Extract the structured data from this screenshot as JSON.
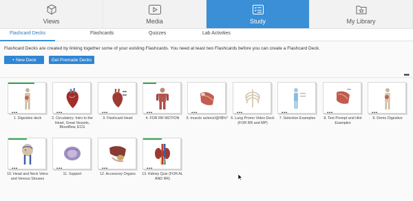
{
  "top_nav": {
    "tabs": [
      {
        "label": "Views",
        "icon": "cube-icon",
        "active": false
      },
      {
        "label": "Media",
        "icon": "play-icon",
        "active": false
      },
      {
        "label": "Study",
        "icon": "checklist-icon",
        "active": true
      },
      {
        "label": "My Library",
        "icon": "star-folder-icon",
        "active": false
      }
    ]
  },
  "sub_nav": {
    "tabs": [
      {
        "label": "Flashcard Decks",
        "active": true
      },
      {
        "label": "Flashcards",
        "active": false
      },
      {
        "label": "Quizzes",
        "active": false
      },
      {
        "label": "Lab Activities",
        "active": false
      }
    ]
  },
  "main": {
    "description": "Flashcard Decks are created by linking together some of your existing Flashcards. You need at least two Flashcards before you can create a Flashcard Deck.",
    "new_deck_label": "+ New Deck",
    "premade_label": "Get Premade Decks",
    "more_glyph": "•••",
    "card_dots": "•••"
  },
  "decks": [
    {
      "label": "1. Digestive deck",
      "progress": 0.7
    },
    {
      "label": "2. Circulatory: Intro to the Heart, Great Vessels, Bloodflow, ECG",
      "progress": 0
    },
    {
      "label": "3. Flashcard Heart",
      "progress": 0
    },
    {
      "label": "4. FOR RR MOTION",
      "progress": 0.35
    },
    {
      "label": "5. muscle actions!@#$%^",
      "progress": 0
    },
    {
      "label": "6. Lung Promo Video Deck (FOR RR and MP)",
      "progress": 0
    },
    {
      "label": "7. Selection Examples",
      "progress": 0
    },
    {
      "label": "8. Text Prompt and Hint Examples",
      "progress": 0
    },
    {
      "label": "9. Demo Digestive",
      "progress": 0
    },
    {
      "label": "10. Head and Neck Veins and Venous Sinuses",
      "progress": 0.5
    },
    {
      "label": "11. Support",
      "progress": 0
    },
    {
      "label": "12. Accessory Organs",
      "progress": 0
    },
    {
      "label": "13. Kidney Quiz (FOR AL AND RR)",
      "progress": 0.5
    }
  ],
  "colors": {
    "accent": "#3a8fd6",
    "button": "#2f86d4",
    "progress": "#2fa84f"
  }
}
